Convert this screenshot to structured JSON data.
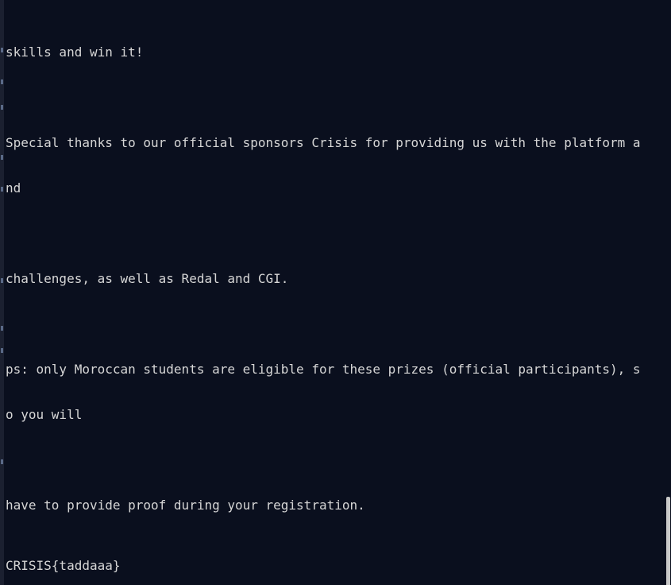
{
  "terminal": {
    "lines": [
      "skills and win it!",
      "",
      "Special thanks to our official sponsors Crisis for providing us with the platform a",
      "nd",
      "",
      "challenges, as well as Redal and CGI.",
      "",
      "ps: only Moroccan students are eligible for these prizes (official participants), s",
      "o you will",
      "",
      "have to provide proof during your registration."
    ],
    "flag": "CRISIS{taddaaa}"
  },
  "scrollbar": {
    "position_fraction": 0.85
  }
}
